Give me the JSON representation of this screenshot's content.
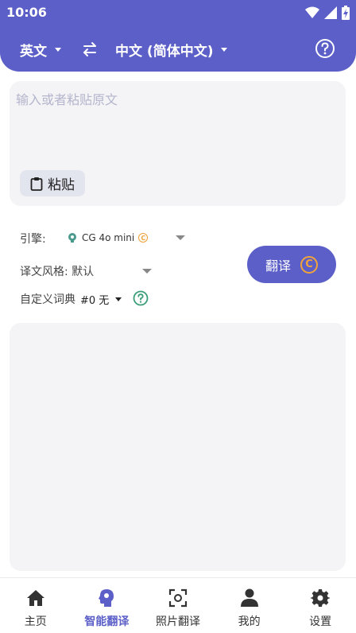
{
  "status_bar": {
    "time": "10:06"
  },
  "header": {
    "source_language": "英文",
    "target_language": "中文 (简体中文)"
  },
  "input": {
    "placeholder": "输入或者粘贴原文",
    "paste_label": "粘贴"
  },
  "options": {
    "engine_label": "引擎:",
    "engine_value": "CG 4o mini",
    "style_label": "译文风格: 默认",
    "dict_label": "自定义词典",
    "dict_value": "#0 无"
  },
  "translate_button": {
    "label": "翻译"
  },
  "bottom_nav": [
    {
      "label": "主页",
      "icon": "home-icon",
      "active": false
    },
    {
      "label": "智能翻译",
      "icon": "smart-translate-icon",
      "active": true
    },
    {
      "label": "照片翻译",
      "icon": "camera-scan-icon",
      "active": false
    },
    {
      "label": "我的",
      "icon": "person-icon",
      "active": false
    },
    {
      "label": "设置",
      "icon": "gear-icon",
      "active": false
    }
  ],
  "colors": {
    "accent": "#5b5fc7",
    "coin": "#f2a33a",
    "card": "#f4f4f6"
  }
}
